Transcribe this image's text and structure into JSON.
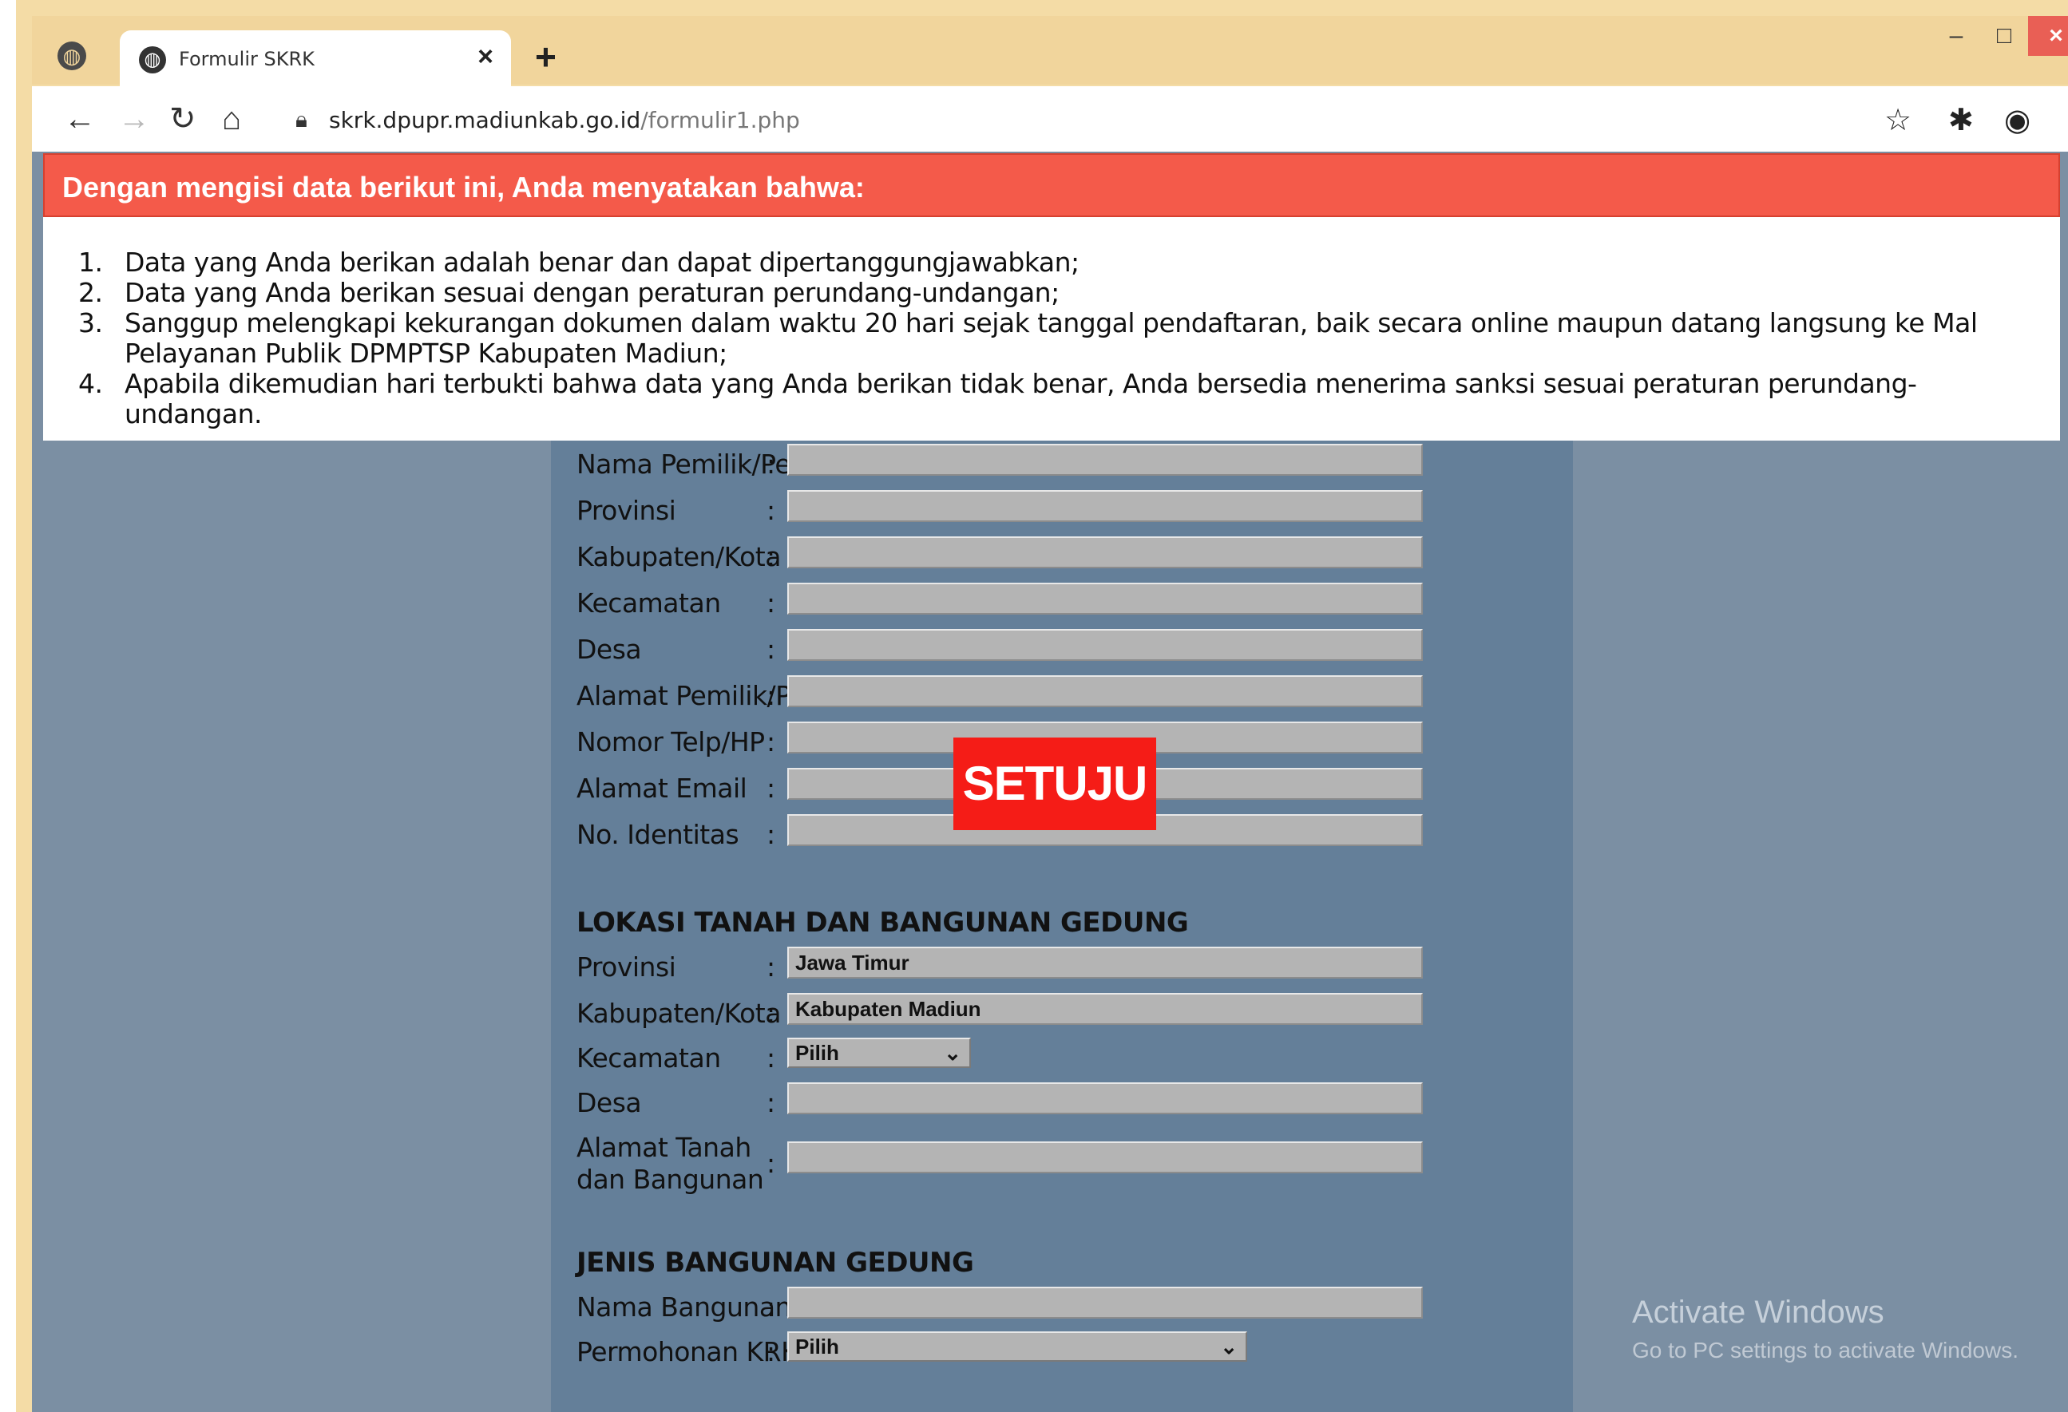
{
  "browser": {
    "tab_title": "Formulir SKRK",
    "url_domain": "skrk.dpupr.madiunkab.go.id",
    "url_path": "/formulir1.php",
    "icons": {
      "inactive_tab": "globe-icon",
      "tab_favicon": "globe-icon",
      "tab_close": "close-icon",
      "new_tab": "plus-icon",
      "back": "arrow-left-icon",
      "forward": "arrow-right-icon",
      "reload": "reload-icon",
      "home": "home-icon",
      "lock": "lock-icon",
      "bookmark": "star-icon",
      "extensions": "puzzle-icon",
      "profile": "account-icon",
      "menu": "kebab-menu-icon"
    }
  },
  "banner": {
    "text": "Dengan mengisi data berikut ini, Anda menyatakan bahwa:",
    "color": "#f45a4a"
  },
  "notice": {
    "items": [
      {
        "num": "1.",
        "text": "Data yang Anda berikan adalah benar dan dapat dipertanggungjawabkan;"
      },
      {
        "num": "2.",
        "text": "Data yang Anda berikan sesuai dengan peraturan perundang-undangan;"
      },
      {
        "num": "3.",
        "text": "Sanggup melengkapi kekurangan dokumen dalam waktu 20 hari sejak tanggal pendaftaran, baik secara online maupun datang langsung ke Mal Pelayanan Publik DPMPTSP Kabupaten Madiun;"
      },
      {
        "num": "4.",
        "text": "Apabila dikemudian hari terbukti bahwa data yang Anda berikan tidak benar, Anda bersedia menerima sanksi sesuai peraturan perundang-undangan."
      }
    ]
  },
  "form": {
    "owner": {
      "nama_label": "Nama Pemilik/Perusahaan",
      "provinsi_label": "Provinsi",
      "kabupaten_label": "Kabupaten/Kota",
      "kecamatan_label": "Kecamatan",
      "desa_label": "Desa",
      "alamat_label": "Alamat Pemilik/Perusahaan",
      "telp_label": "Nomor Telp/HP",
      "email_label": "Alamat Email",
      "identitas_label": "No. Identitas"
    },
    "lokasi": {
      "title": "LOKASI TANAH DAN BANGUNAN GEDUNG",
      "provinsi_label": "Provinsi",
      "provinsi_value": "Jawa Timur",
      "kabupaten_label": "Kabupaten/Kota",
      "kabupaten_value": "Kabupaten Madiun",
      "kecamatan_label": "Kecamatan",
      "kecamatan_value": "Pilih",
      "desa_label": "Desa",
      "alamat_label": "Alamat Tanah dan Bangunan"
    },
    "jenis": {
      "title": "JENIS BANGUNAN GEDUNG",
      "nama_label": "Nama Bangunan",
      "permohonan_label": "Permohonan KRK",
      "permohonan_value": "Pilih"
    },
    "colon": ":"
  },
  "setuju_button": {
    "label": "SETUJU",
    "color": "#f51c17"
  },
  "watermark": {
    "line1": "Activate Windows",
    "line2": "Go to PC settings to activate Windows."
  }
}
